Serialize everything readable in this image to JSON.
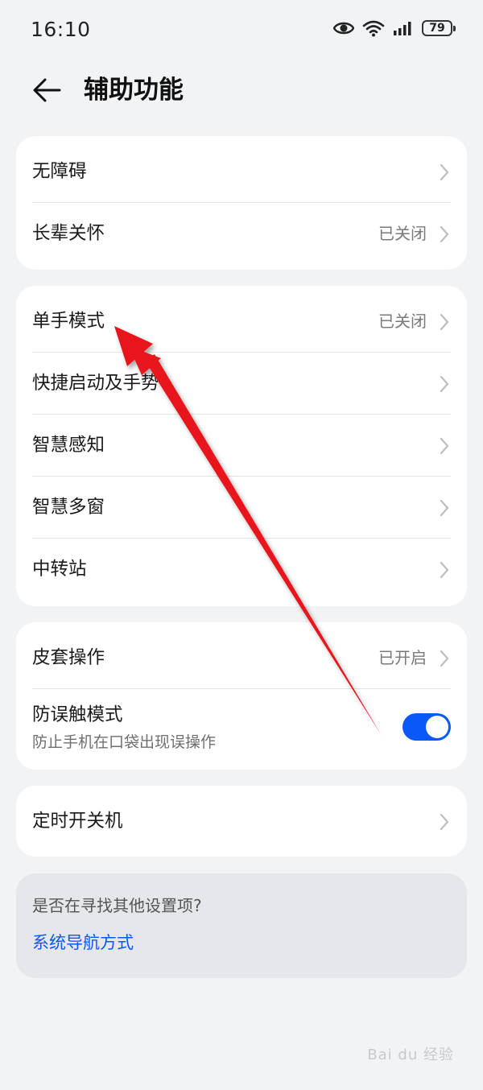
{
  "status_bar": {
    "time": "16:10",
    "battery": "79",
    "icons": [
      "eye-icon",
      "wifi-icon",
      "signal-icon",
      "battery-icon"
    ]
  },
  "header": {
    "title": "辅助功能"
  },
  "groups": [
    {
      "items": [
        {
          "label": "无障碍",
          "value": ""
        },
        {
          "label": "长辈关怀",
          "value": "已关闭"
        }
      ]
    },
    {
      "items": [
        {
          "label": "单手模式",
          "value": "已关闭"
        },
        {
          "label": "快捷启动及手势",
          "value": ""
        },
        {
          "label": "智慧感知",
          "value": ""
        },
        {
          "label": "智慧多窗",
          "value": ""
        },
        {
          "label": "中转站",
          "value": ""
        }
      ]
    },
    {
      "items": [
        {
          "label": "皮套操作",
          "value": "已开启"
        },
        {
          "label": "防误触模式",
          "subtitle": "防止手机在口袋出现误操作",
          "toggle": true
        }
      ]
    },
    {
      "items": [
        {
          "label": "定时开关机",
          "value": ""
        }
      ]
    }
  ],
  "suggestion": {
    "question": "是否在寻找其他设置项?",
    "link": "系统导航方式"
  },
  "watermark": "Bai du 经验",
  "colors": {
    "accent": "#0a59f7",
    "background": "#f1f3f5",
    "arrow": "#e8141a"
  }
}
